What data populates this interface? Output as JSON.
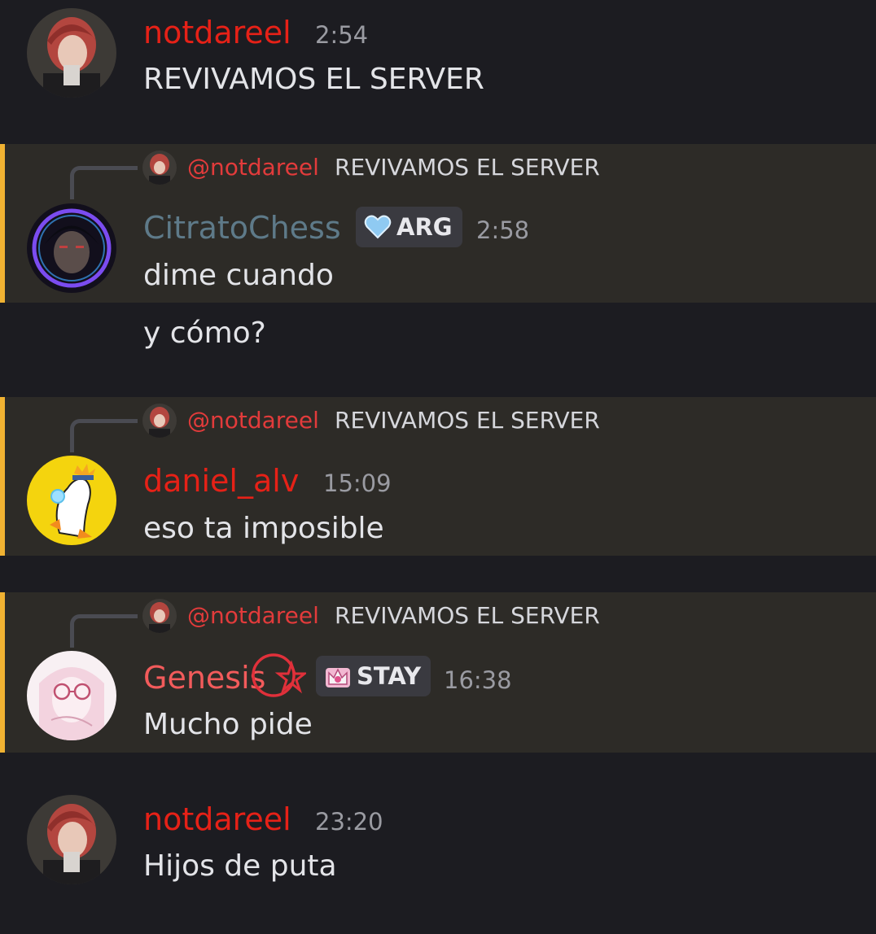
{
  "colors": {
    "background": "#1c1c21",
    "mention_highlight": "#2d2b27",
    "mention_bar": "#f0b232",
    "notdareel_name": "#e62117",
    "citrato_name": "#5e7a89",
    "daniel_name": "#e62117",
    "genesis_name": "#f25b5b"
  },
  "messages": [
    {
      "author": "notdareel",
      "time": "2:54",
      "lines": [
        "REVIVAMOS EL SERVER"
      ]
    },
    {
      "reply": {
        "mention": "@notdareel",
        "text": "REVIVAMOS EL SERVER"
      },
      "author": "CitratoChess",
      "tag": {
        "icon": "heart-icon",
        "label": "ARG"
      },
      "time": "2:58",
      "lines": [
        "dime cuando",
        "y cómo?"
      ]
    },
    {
      "reply": {
        "mention": "@notdareel",
        "text": "REVIVAMOS EL SERVER"
      },
      "author": "daniel_alv",
      "time": "15:09",
      "lines": [
        "eso ta imposible"
      ]
    },
    {
      "reply": {
        "mention": "@notdareel",
        "text": "REVIVAMOS EL SERVER"
      },
      "author": "Genesis",
      "author_emoji": "star-circle-emoji",
      "tag": {
        "icon": "crown-badge-icon",
        "label": "STAY"
      },
      "time": "16:38",
      "lines": [
        "Mucho pide"
      ]
    },
    {
      "author": "notdareel",
      "time": "23:20",
      "lines": [
        "Hijos de puta"
      ]
    }
  ]
}
